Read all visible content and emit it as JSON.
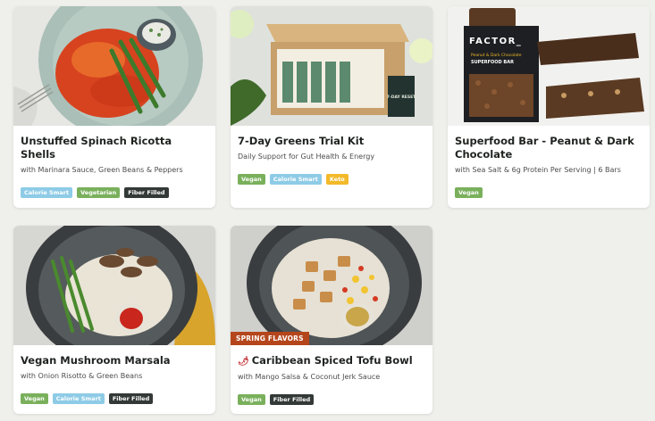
{
  "cards": [
    {
      "title": "Unstuffed Spinach Ricotta Shells",
      "subtitle": "with Marinara Sauce, Green Beans & Peppers",
      "tags": [
        "Calorie Smart",
        "Vegetarian",
        "Fiber Filled"
      ]
    },
    {
      "title": "7-Day Greens Trial Kit",
      "subtitle": "Daily Support for Gut Health & Energy",
      "tags": [
        "Vegan",
        "Calorie Smart",
        "Keto"
      ],
      "box_text": "7-DAY RESET"
    },
    {
      "title": "Superfood Bar - Peanut & Dark Chocolate",
      "subtitle": "with Sea Salt & 6g Protein Per Serving | 6 Bars",
      "tags": [
        "Vegan"
      ],
      "pack_brand": "FACTOR_",
      "pack_flavor": "Peanut & Dark Chocolate",
      "pack_name": "SUPERFOOD BAR"
    },
    {
      "title": "Vegan Mushroom Marsala",
      "subtitle": "with Onion Risotto & Green Beans",
      "tags": [
        "Vegan",
        "Calorie Smart",
        "Fiber Filled"
      ]
    },
    {
      "title": "Caribbean Spiced Tofu Bowl",
      "subtitle": "with Mango Salsa & Coconut Jerk Sauce",
      "tags": [
        "Vegan",
        "Fiber Filled"
      ],
      "badge": "SPRING FLAVORS",
      "title_icon": "chili-pepper-icon"
    }
  ]
}
